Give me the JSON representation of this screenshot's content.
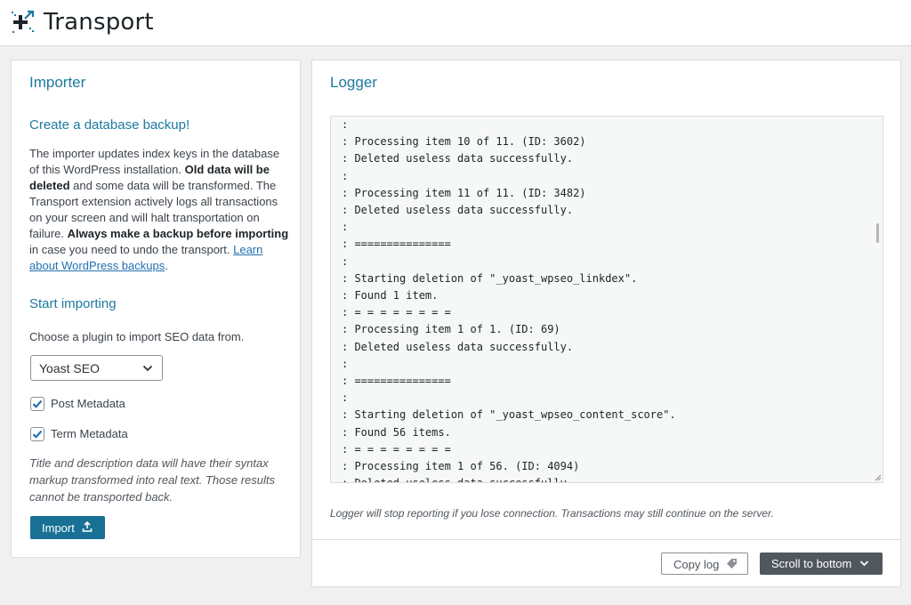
{
  "header": {
    "app_title": "Transport"
  },
  "importer": {
    "title": "Importer",
    "backup_heading": "Create a database backup!",
    "backup_text": {
      "p1": "The importer updates index keys in the database of this WordPress installation. ",
      "b1": "Old data will be deleted",
      "p2": " and some data will be transformed. The Transport extension actively logs all transactions on your screen and will halt transportation on failure. ",
      "b2": "Always make a backup before importing",
      "p3": " in case you need to undo the transport. ",
      "link": "Learn about WordPress backups",
      "p4": "."
    },
    "start_heading": "Start importing",
    "choose_label": "Choose a plugin to import SEO data from.",
    "plugin_select": {
      "value": "Yoast SEO"
    },
    "options": [
      {
        "label": "Post Metadata",
        "checked": true
      },
      {
        "label": "Term Metadata",
        "checked": true
      }
    ],
    "note": "Title and description data will have their syntax markup transformed into real text. Those results cannot be transported back.",
    "import_button": "Import"
  },
  "logger": {
    "title": "Logger",
    "lines": [
      ":",
      ": Processing item 10 of 11. (ID: 3602)",
      ": Deleted useless data successfully.",
      ":",
      ": Processing item 11 of 11. (ID: 3482)",
      ": Deleted useless data successfully.",
      ":",
      ": ===============",
      ":",
      ": Starting deletion of \"_yoast_wpseo_linkdex\".",
      ": Found 1 item.",
      ": = = = = = = = =",
      ": Processing item 1 of 1. (ID: 69)",
      ": Deleted useless data successfully.",
      ":",
      ": ===============",
      ":",
      ": Starting deletion of \"_yoast_wpseo_content_score\".",
      ": Found 56 items.",
      ": = = = = = = = =",
      ": Processing item 1 of 56. (ID: 4094)",
      ": Deleted useless data successfully."
    ],
    "note": "Logger will stop reporting if you lose connection. Transactions may still continue on the server.",
    "copy_button": "Copy log",
    "scroll_button": "Scroll to bottom"
  }
}
